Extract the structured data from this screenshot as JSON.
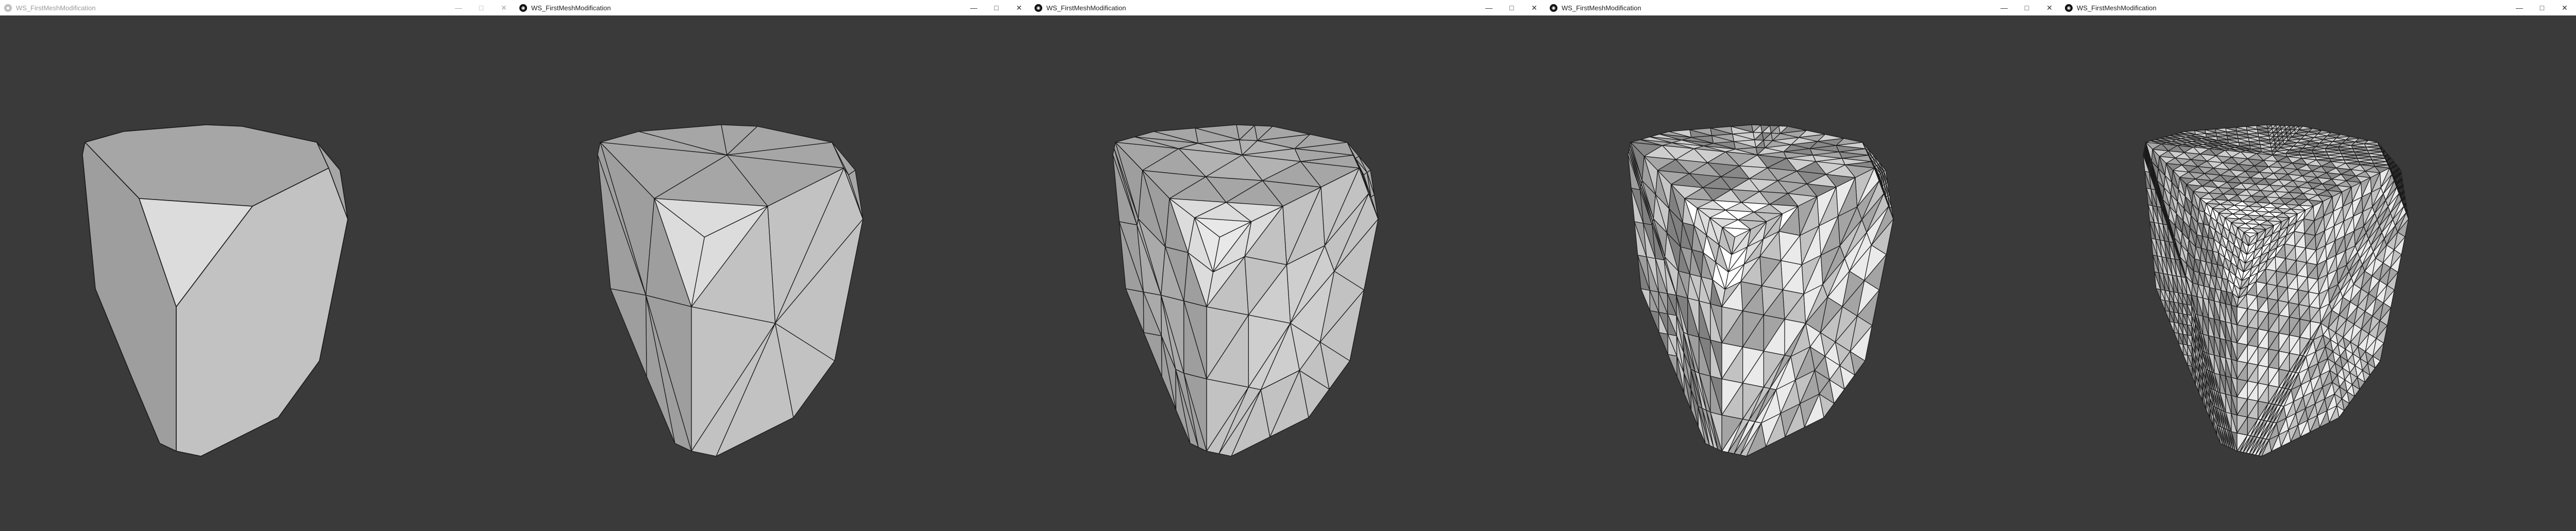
{
  "windows": [
    {
      "title": "WS_FirstMeshModification",
      "active": false,
      "subdivision_level": 0
    },
    {
      "title": "WS_FirstMeshModification",
      "active": true,
      "subdivision_level": 1
    },
    {
      "title": "WS_FirstMeshModification",
      "active": true,
      "subdivision_level": 2
    },
    {
      "title": "WS_FirstMeshModification",
      "active": true,
      "subdivision_level": 3
    },
    {
      "title": "WS_FirstMeshModification",
      "active": true,
      "subdivision_level": 4
    }
  ],
  "controls": {
    "minimize_glyph": "—",
    "maximize_glyph": "□",
    "close_glyph": "✕"
  },
  "app_icon_glyph": "◉",
  "colors": {
    "background": "#3a3a3a",
    "titlebar": "#ffffff",
    "face_top": "#a6a6a6",
    "face_front": "#c2c2c2",
    "face_left": "#9e9e9e",
    "face_highlight": "#dcdcdc",
    "edge": "#1a1a1a"
  }
}
